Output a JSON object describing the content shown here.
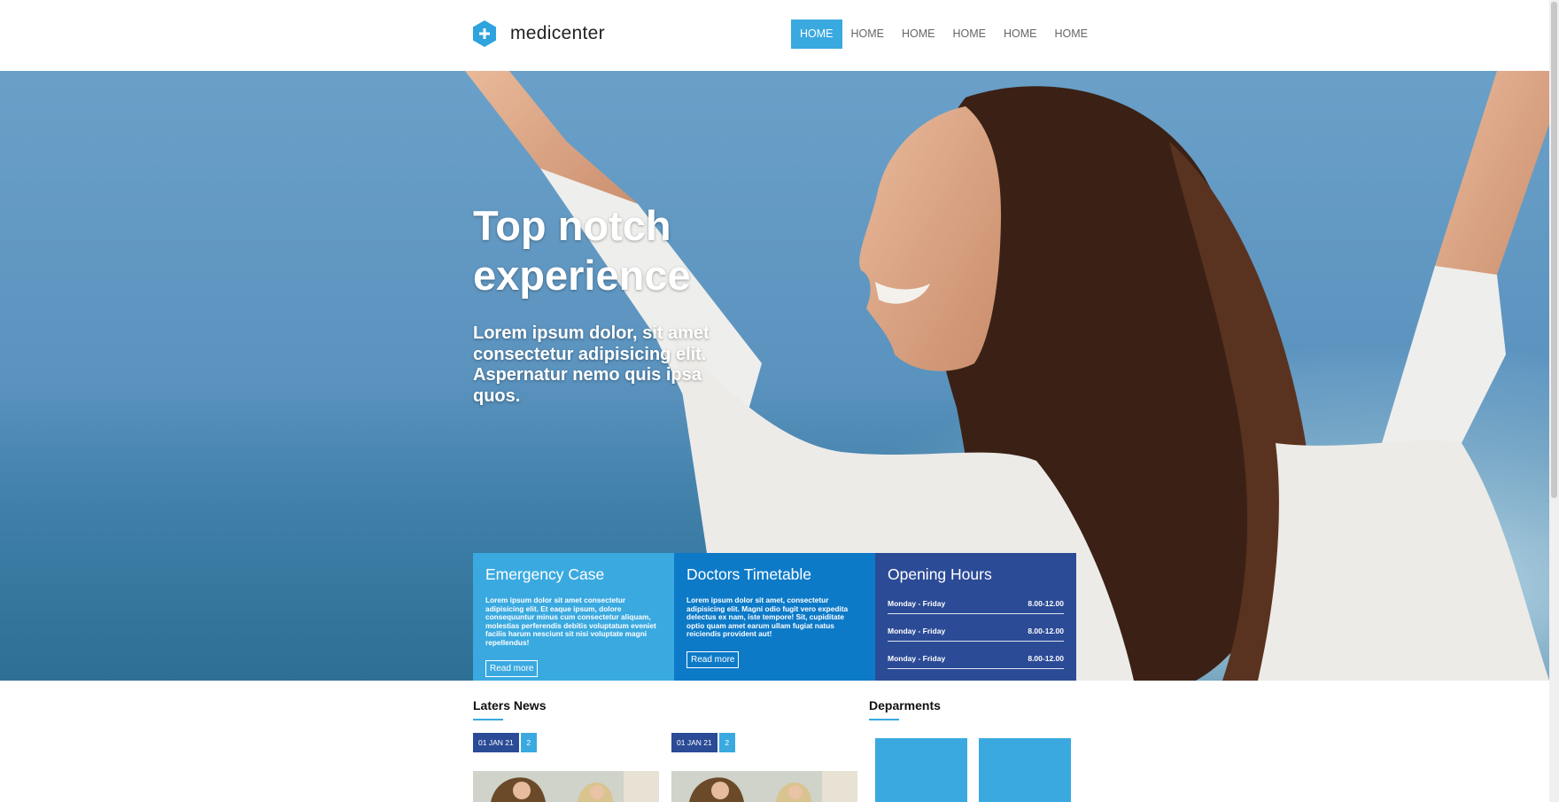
{
  "brand": {
    "name": "medicenter",
    "accent": "#3aa9e0"
  },
  "nav": {
    "items": [
      {
        "label": "HOME",
        "active": true
      },
      {
        "label": "HOME",
        "active": false
      },
      {
        "label": "HOME",
        "active": false
      },
      {
        "label": "HOME",
        "active": false
      },
      {
        "label": "HOME",
        "active": false
      },
      {
        "label": "HOME",
        "active": false
      }
    ]
  },
  "hero": {
    "title_line1": "Top notch",
    "title_line2": "experience",
    "subtitle": "Lorem ipsum dolor, sit amet consectetur adipisicing elit. Aspernatur nemo quis ipsa quos."
  },
  "boxes": {
    "emergency": {
      "title": "Emergency Case",
      "text": "Lorem ipsum dolor sit amet consectetur adipisicing elit. Et eaque ipsum, dolore consequuntur minus cum consectetur aliquam, molestias perferendis debitis voluptatum eveniet facilis harum nesciunt sit nisi voluptate magni repellendus!",
      "button": "Read more",
      "color": "#3aa9e0"
    },
    "doctors": {
      "title": "Doctors Timetable",
      "text": "Lorem ipsum dolor sit amet, consectetur adipisicing elit. Magni odio fugit vero expedita delectus ex nam, iste tempore! Sit, cupiditate optio quam amet earum ullam fugiat natus reiciendis provident aut!",
      "button": "Read more",
      "color": "#0d7ac8"
    },
    "hours": {
      "title": "Opening Hours",
      "color": "#2b4b96",
      "rows": [
        {
          "day": "Monday - Friday",
          "time": "8.00-12.00"
        },
        {
          "day": "Monday - Friday",
          "time": "8.00-12.00"
        },
        {
          "day": "Monday - Friday",
          "time": "8.00-12.00"
        }
      ]
    }
  },
  "news": {
    "title": "Laters News",
    "items": [
      {
        "date": "01 JAN 21",
        "count": "2"
      },
      {
        "date": "01 JAN 21",
        "count": "2"
      }
    ]
  },
  "departments": {
    "title": "Deparments"
  }
}
